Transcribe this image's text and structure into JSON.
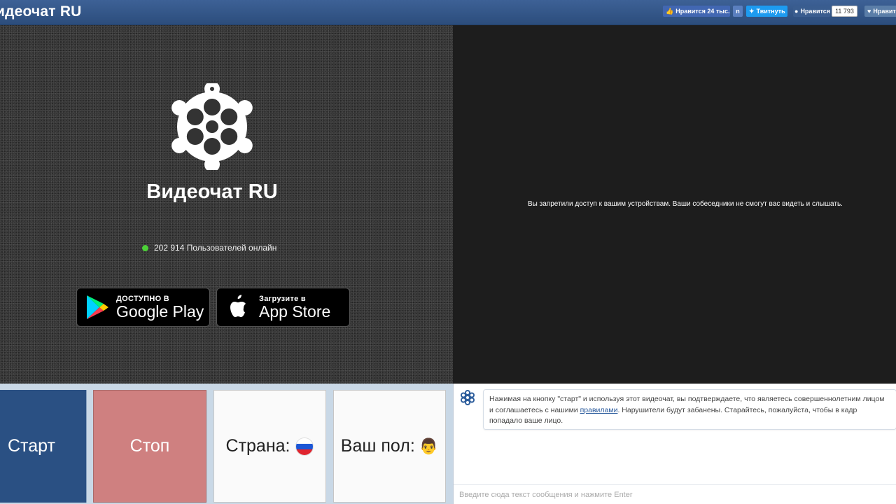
{
  "header": {
    "title": "идеочат RU",
    "social": {
      "fb_label": "Нравится 24 тыс.",
      "n_label": "n",
      "tw_label": "Твитнуть",
      "ok_label": "Нравится",
      "ok_count": "11 793",
      "vk_label": "Нравит"
    }
  },
  "left_panel": {
    "brand": "Видеочат RU",
    "online_text": "202 914 Пользователей онлайн",
    "google_play": {
      "small": "ДОСТУПНО В",
      "big": "Google Play"
    },
    "app_store": {
      "small": "Загрузите в",
      "big": "App Store"
    }
  },
  "right_panel": {
    "message": "Вы запретили доступ к вашим устройствам. Ваши собеседники не смогут вас видеть и слышать."
  },
  "controls": {
    "start_label": "Старт",
    "stop_label": "Стоп",
    "country_label": "Страна:",
    "gender_label": "Ваш пол:"
  },
  "chat": {
    "notice_before": "Нажимая на кнопку \"старт\" и используя этот видеочат, вы подтверждаете, что являетесь совершеннолетним лицом и соглашаетесь с нашими ",
    "notice_link": "правилами",
    "notice_after": ". Нарушители будут забанены. Старайтесь, пожалуйста, чтобы в кадр попадало ваше лицо.",
    "input_placeholder": "Введите сюда текст сообщения и нажмите Enter"
  },
  "colors": {
    "header": "#2f5284",
    "start": "#2a5083",
    "stop": "#cf8080",
    "online_dot": "#4cd137"
  }
}
